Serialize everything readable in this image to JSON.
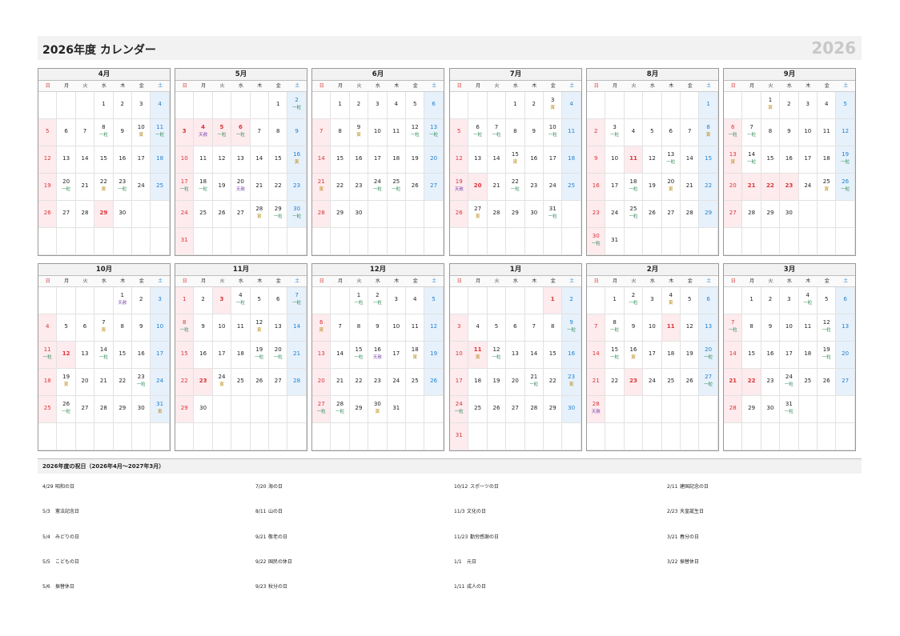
{
  "header": {
    "title": "2026年度 カレンダー",
    "year": "2026"
  },
  "weekdays": [
    "日",
    "月",
    "火",
    "水",
    "木",
    "金",
    "土"
  ],
  "tag_labels": {
    "ichi": "一粒",
    "tora": "寅",
    "ten": "天赦"
  },
  "months": [
    {
      "name": "4月",
      "start": 3,
      "days": 30,
      "holidays": [
        29
      ],
      "tags": {
        "8": "ichi",
        "10": "tora",
        "11": "ichi",
        "20": "ichi",
        "22": "tora",
        "23": "ichi"
      }
    },
    {
      "name": "5月",
      "start": 5,
      "days": 31,
      "holidays": [
        3,
        4,
        5,
        6
      ],
      "tags": {
        "2": "ichi",
        "4": "ten",
        "5": "ichi",
        "6": "ichi",
        "16": "tora",
        "17": "ichi",
        "18": "ichi",
        "20": "ten",
        "28": "tora",
        "29": "ichi",
        "30": "ichi"
      }
    },
    {
      "name": "6月",
      "start": 1,
      "days": 30,
      "holidays": [],
      "tags": {
        "9": "tora",
        "12": "ichi",
        "13": "ichi",
        "21": "tora",
        "24": "ichi",
        "25": "ichi"
      }
    },
    {
      "name": "7月",
      "start": 3,
      "days": 31,
      "holidays": [
        20
      ],
      "tags": {
        "3": "tora",
        "6": "ichi",
        "7": "ichi",
        "10": "ichi",
        "15": "tora",
        "19": "ten",
        "22": "ichi",
        "27": "tora",
        "31": "ichi"
      }
    },
    {
      "name": "8月",
      "start": 6,
      "days": 31,
      "holidays": [
        11
      ],
      "tags": {
        "3": "ichi",
        "8": "tora",
        "13": "ichi",
        "18": "ichi",
        "20": "tora",
        "25": "ichi",
        "30": "ichi"
      }
    },
    {
      "name": "9月",
      "start": 2,
      "days": 30,
      "holidays": [
        21,
        22,
        23
      ],
      "tags": {
        "1": "tora",
        "6": "ichi",
        "7": "ichi",
        "13": "tora",
        "14": "ichi",
        "19": "ichi",
        "25": "tora",
        "26": "ichi"
      }
    },
    {
      "name": "10月",
      "start": 4,
      "days": 31,
      "holidays": [
        12
      ],
      "tags": {
        "1": "ten",
        "7": "tora",
        "11": "ichi",
        "14": "ichi",
        "19": "tora",
        "23": "ichi",
        "26": "ichi",
        "31": "tora"
      }
    },
    {
      "name": "11月",
      "start": 0,
      "days": 30,
      "holidays": [
        3,
        23
      ],
      "tags": {
        "4": "ichi",
        "7": "ichi",
        "8": "ichi",
        "12": "tora",
        "19": "ichi",
        "20": "ichi",
        "24": "tora"
      }
    },
    {
      "name": "12月",
      "start": 2,
      "days": 31,
      "holidays": [],
      "tags": {
        "1": "ichi",
        "2": "ichi",
        "6": "tora",
        "15": "ichi",
        "16": "ten",
        "18": "tora",
        "27": "ichi",
        "28": "ichi",
        "30": "tora"
      }
    },
    {
      "name": "1月",
      "start": 5,
      "days": 31,
      "holidays": [
        1,
        11
      ],
      "tags": {
        "9": "ichi",
        "11": "tora",
        "12": "ichi",
        "21": "ichi",
        "23": "tora",
        "24": "ichi"
      }
    },
    {
      "name": "2月",
      "start": 1,
      "days": 28,
      "holidays": [
        11,
        23
      ],
      "tags": {
        "2": "ichi",
        "4": "tora",
        "8": "ichi",
        "15": "ichi",
        "16": "tora",
        "20": "ichi",
        "27": "ichi",
        "28": "ten"
      }
    },
    {
      "name": "3月",
      "start": 1,
      "days": 31,
      "holidays": [
        21,
        22
      ],
      "tags": {
        "4": "ichi",
        "7": "ichi",
        "12": "ichi",
        "19": "ichi",
        "24": "ichi",
        "31": "ichi"
      }
    }
  ],
  "holidays_section": {
    "title": "2026年度の祝日（2026年4月～2027年3月）",
    "columns": [
      [
        {
          "date": "4/29",
          "name": "昭和の日"
        },
        {
          "date": "5/3",
          "name": "憲法記念日"
        },
        {
          "date": "5/4",
          "name": "みどりの日"
        },
        {
          "date": "5/5",
          "name": "こどもの日"
        },
        {
          "date": "5/6",
          "name": "振替休日"
        }
      ],
      [
        {
          "date": "7/20",
          "name": "海の日"
        },
        {
          "date": "8/11",
          "name": "山の日"
        },
        {
          "date": "9/21",
          "name": "敬老の日"
        },
        {
          "date": "9/22",
          "name": "国民の休日"
        },
        {
          "date": "9/23",
          "name": "秋分の日"
        }
      ],
      [
        {
          "date": "10/12",
          "name": "スポーツの日"
        },
        {
          "date": "11/3",
          "name": "文化の日"
        },
        {
          "date": "11/23",
          "name": "勤労感謝の日"
        },
        {
          "date": "1/1",
          "name": "元日"
        },
        {
          "date": "1/11",
          "name": "成人の日"
        }
      ],
      [
        {
          "date": "2/11",
          "name": "建国記念の日"
        },
        {
          "date": "2/23",
          "name": "天皇誕生日"
        },
        {
          "date": "3/21",
          "name": "春分の日"
        },
        {
          "date": "3/22",
          "name": "振替休日"
        }
      ]
    ]
  }
}
